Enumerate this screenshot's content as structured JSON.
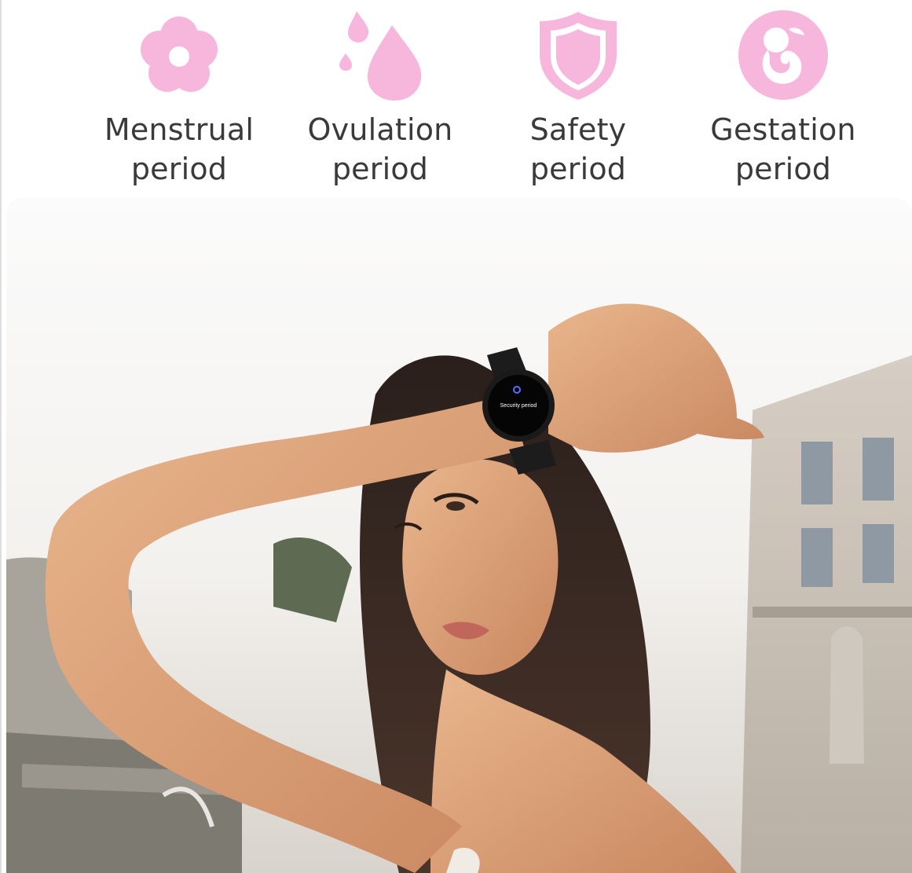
{
  "features": [
    {
      "id": "menstrual",
      "icon": "flower-icon",
      "line1": "Menstrual",
      "line2": "period"
    },
    {
      "id": "ovulation",
      "icon": "droplets-icon",
      "line1": "Ovulation",
      "line2": "period"
    },
    {
      "id": "safety",
      "icon": "shield-icon",
      "line1": "Safety",
      "line2": "period"
    },
    {
      "id": "gestation",
      "icon": "fetus-icon",
      "line1": "Gestation",
      "line2": "period"
    }
  ],
  "colors": {
    "accent_pink": "#f7b6dc",
    "accent_pink_dark": "#f29fcf",
    "label_text": "#3a3a3a",
    "background": "#ffffff"
  },
  "photo": {
    "watch_screen_text": "Security period"
  }
}
